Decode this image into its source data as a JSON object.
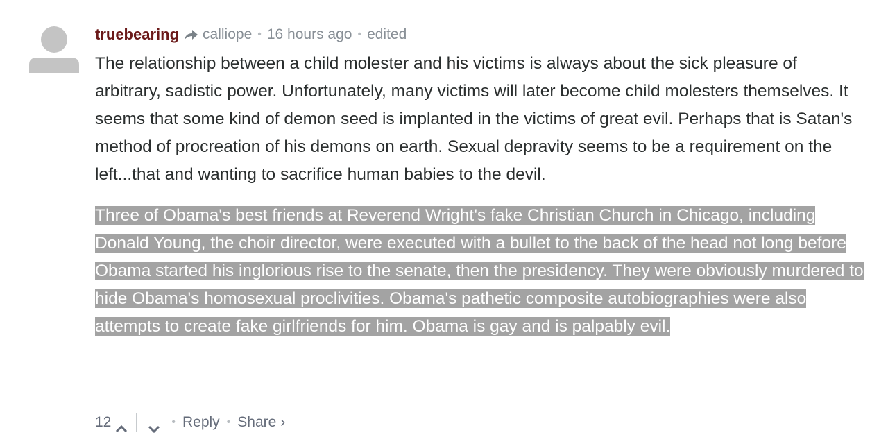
{
  "comment": {
    "author": "truebearing",
    "reply_to": "calliope",
    "timestamp": "16 hours ago",
    "edited_label": "edited",
    "separator": "•",
    "paragraph_1": "The relationship between a child molester and his victims is always about the sick pleasure of arbitrary, sadistic power. Unfortunately, many victims will later become child molesters themselves. It seems that some kind of demon seed is implanted in the victims of great evil. Perhaps that is Satan's method of procreation of his demons on earth. Sexual depravity seems to be a requirement on the left...that and wanting to sacrifice human babies to the devil.",
    "paragraph_2": "Three of Obama's best friends at Reverend Wright's fake Christian Church in Chicago, including Donald Young, the choir director, were executed with a bullet to the back of the head not long before Obama started his inglorious rise to the senate, then the presidency. They were obviously murdered to hide Obama's homosexual proclivities. Obama's pathetic composite autobiographies were also attempts to create fake girlfriends for him. Obama is gay and is palpably evil.",
    "icons": {
      "avatar": "default-avatar-icon",
      "reply_arrow": "reply-arrow-icon",
      "upvote": "chevron-up-icon",
      "downvote": "chevron-down-icon"
    },
    "colors": {
      "author": "#6b1a1a",
      "meta": "#888f96",
      "text": "#2a2e2e",
      "highlight": "#a3a3a3"
    }
  },
  "footer": {
    "votes": "12",
    "reply_label": "Reply",
    "share_label": "Share ›"
  }
}
